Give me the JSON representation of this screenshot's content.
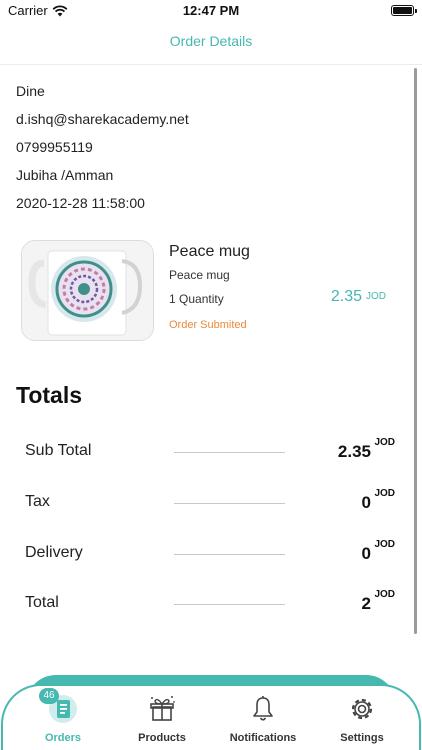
{
  "status_bar": {
    "carrier": "Carrier",
    "time": "12:47 PM"
  },
  "nav": {
    "title": "Order Details"
  },
  "customer": {
    "name": "Dine",
    "email": "d.ishq@sharekacademy.net",
    "phone": "0799955119",
    "address": "Jubiha /Amman",
    "datetime": "2020-12-28 11:58:00"
  },
  "product": {
    "name": "Peace mug",
    "subtitle": "Peace mug",
    "quantity": "1 Quantity",
    "price": "2.35",
    "currency": "JOD",
    "status": "Order Submited"
  },
  "totals": {
    "title": "Totals",
    "rows": [
      {
        "label": "Sub Total",
        "value": "2.35",
        "currency": "JOD"
      },
      {
        "label": "Tax",
        "value": "0",
        "currency": "JOD"
      },
      {
        "label": "Delivery",
        "value": "0",
        "currency": "JOD"
      },
      {
        "label": "Total",
        "value": "2",
        "currency": "JOD"
      }
    ]
  },
  "tabbar": {
    "orders_badge": "46",
    "tabs": [
      {
        "label": "Orders",
        "icon": "orders-icon",
        "active": true
      },
      {
        "label": "Products",
        "icon": "gift-box-icon",
        "active": false
      },
      {
        "label": "Notifications",
        "icon": "bell-icon",
        "active": false
      },
      {
        "label": "Settings",
        "icon": "gear-icon",
        "active": false
      }
    ]
  },
  "colors": {
    "accent": "#45b8b0",
    "status_orange": "#e98a3a"
  }
}
